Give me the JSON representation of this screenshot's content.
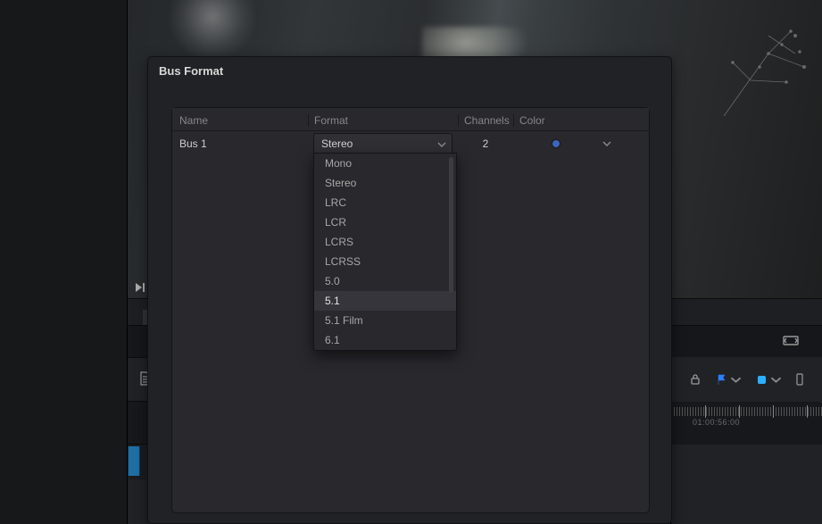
{
  "dialog": {
    "title": "Bus Format",
    "columns": {
      "name": "Name",
      "format": "Format",
      "channels": "Channels",
      "color": "Color"
    },
    "row": {
      "name": "Bus 1",
      "format_selected": "Stereo",
      "channels": "2",
      "color_hex": "#3b66bb"
    },
    "format_options": [
      "Mono",
      "Stereo",
      "LRC",
      "LCR",
      "LCRS",
      "LCRSS",
      "5.0",
      "5.1",
      "5.1 Film",
      "6.1"
    ],
    "format_highlight_index": 7
  },
  "timecode": {
    "label": "01:00:56:00"
  },
  "icons": {
    "skip_next": "skip-next-icon",
    "expand": "expand-icon",
    "page": "page-icon",
    "lock": "lock-icon",
    "flag_blue": "#2b7fff",
    "flag_teal": "#2bb0ff"
  }
}
